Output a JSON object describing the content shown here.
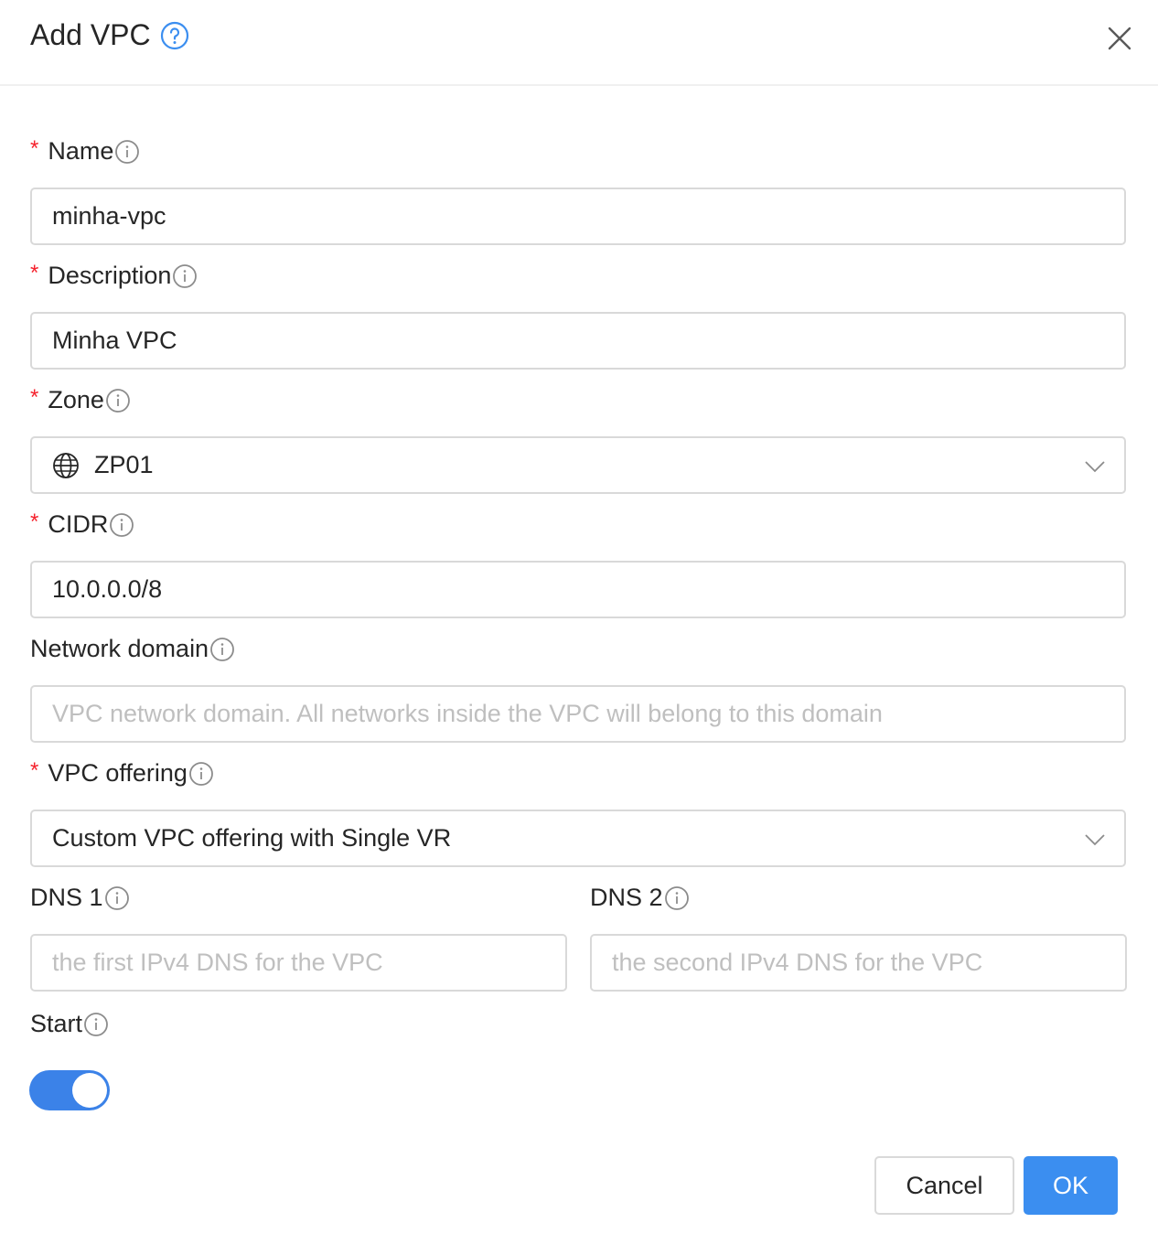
{
  "dialog": {
    "title": "Add VPC"
  },
  "fields": {
    "name": {
      "label": "Name",
      "required": true,
      "value": "minha-vpc"
    },
    "description": {
      "label": "Description",
      "required": true,
      "value": "Minha VPC"
    },
    "zone": {
      "label": "Zone",
      "required": true,
      "value": "ZP01"
    },
    "cidr": {
      "label": "CIDR",
      "required": true,
      "value": "10.0.0.0/8"
    },
    "network_domain": {
      "label": "Network domain",
      "required": false,
      "value": "",
      "placeholder": "VPC network domain. All networks inside the VPC will belong to this domain"
    },
    "vpc_offering": {
      "label": "VPC offering",
      "required": true,
      "value": "Custom VPC offering with Single VR"
    },
    "dns1": {
      "label": "DNS 1",
      "value": "",
      "placeholder": "the first IPv4 DNS for the VPC"
    },
    "dns2": {
      "label": "DNS 2",
      "value": "",
      "placeholder": "the second IPv4 DNS for the VPC"
    },
    "start": {
      "label": "Start",
      "on": true
    }
  },
  "buttons": {
    "cancel": "Cancel",
    "ok": "OK"
  },
  "colors": {
    "accent": "#3b8ef0",
    "required": "#f5222d",
    "border": "#d9d9d9",
    "placeholder": "#bfbfbf"
  },
  "required_mark": "*"
}
